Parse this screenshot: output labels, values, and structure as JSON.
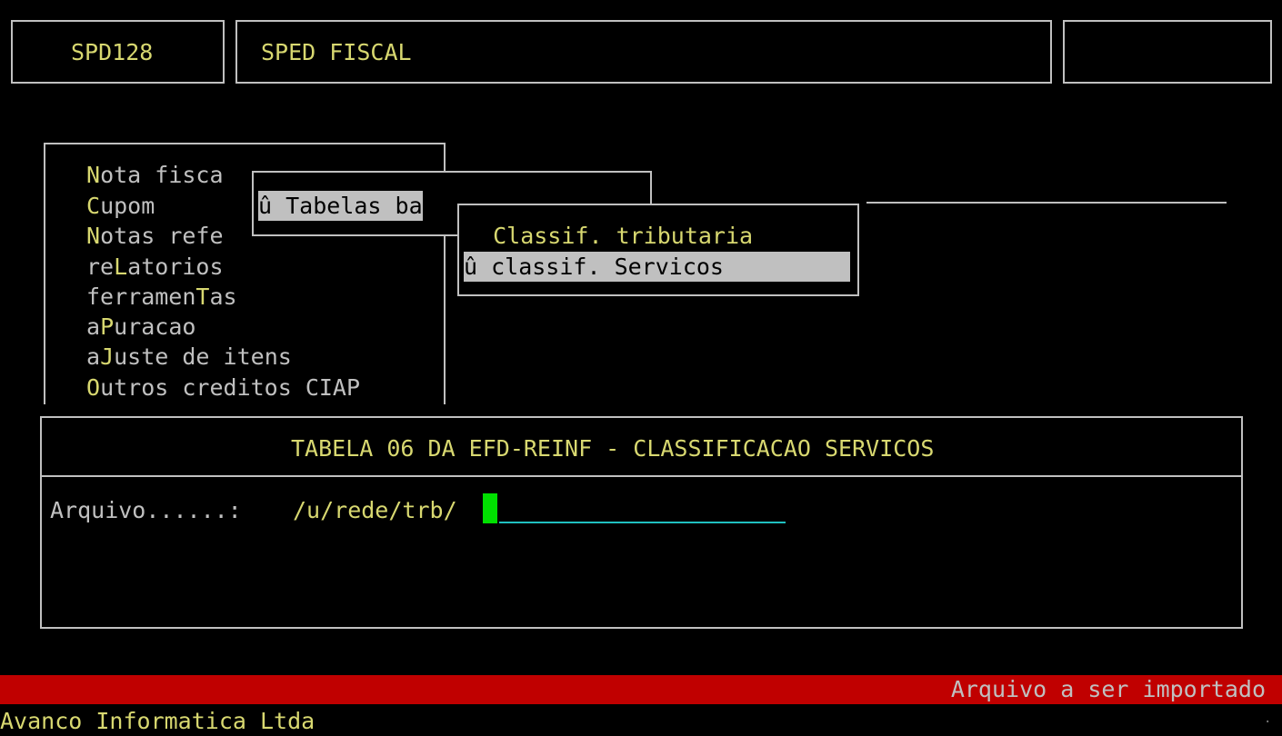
{
  "header": {
    "program_code": "SPD128",
    "program_title": "SPED FISCAL",
    "right_box": ""
  },
  "main_menu": {
    "items": [
      {
        "hotkey": "N",
        "rest": "ota fisca"
      },
      {
        "hotkey": "C",
        "rest": "upom"
      },
      {
        "hotkey": "N",
        "rest": "otas refe"
      },
      {
        "pre": "re",
        "hotkey": "L",
        "rest": "atorios"
      },
      {
        "pre": "ferramen",
        "hotkey": "T",
        "rest": "as"
      },
      {
        "pre": "a",
        "hotkey": "P",
        "rest": "uracao"
      },
      {
        "pre": "a",
        "hotkey": "J",
        "rest": "uste de itens"
      },
      {
        "hotkey": "O",
        "rest": "utros creditos CIAP"
      }
    ]
  },
  "submenu": {
    "selected_item": "û Tabelas ba"
  },
  "sub_submenu": {
    "items": [
      "  Classif. tributaria",
      "û classif. Servicos"
    ],
    "selected_index": 1
  },
  "dialog": {
    "title": "TABELA 06 DA EFD-REINF - CLASSIFICACAO SERVICOS",
    "field_label": "Arquivo......:",
    "field_value": "/u/rede/trb/"
  },
  "status_bar": {
    "message": "Arquivo a ser importado"
  },
  "footer": {
    "company": "Avanco Informatica Ltda",
    "corner_mark": "."
  },
  "colors": {
    "background": "#000000",
    "text": "#c0c0c0",
    "highlight": "#d8d870",
    "status_bar": "#c00000",
    "cursor": "#00e000",
    "field_underline": "#20c0c0"
  }
}
